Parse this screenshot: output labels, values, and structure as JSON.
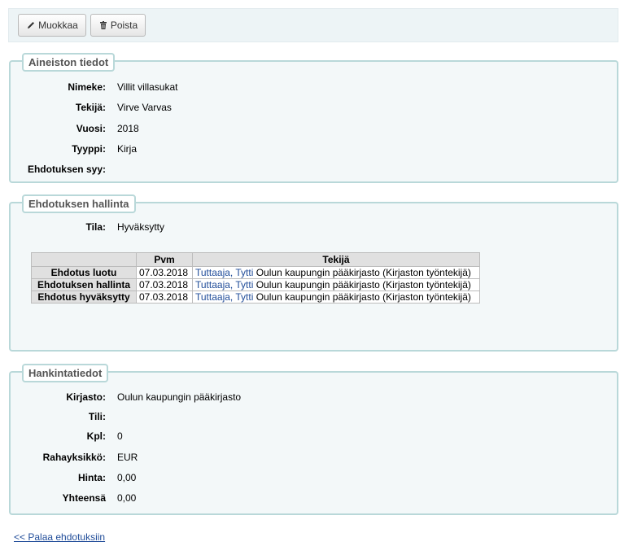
{
  "toolbar": {
    "edit_label": "Muokkaa",
    "edit_icon": "pencil-icon",
    "delete_label": "Poista",
    "delete_icon": "trash-icon"
  },
  "material": {
    "legend": "Aineiston tiedot",
    "fields": [
      {
        "label": "Nimeke:",
        "value": "Villit villasukat"
      },
      {
        "label": "Tekijä:",
        "value": "Virve Varvas"
      },
      {
        "label": "Vuosi:",
        "value": "2018"
      },
      {
        "label": "Tyyppi:",
        "value": "Kirja"
      },
      {
        "label": "Ehdotuksen syy:",
        "value": ""
      }
    ]
  },
  "management": {
    "legend": "Ehdotuksen hallinta",
    "status_label": "Tila:",
    "status_value": "Hyväksytty",
    "history": {
      "headers": [
        "",
        "Pvm",
        "Tekijä"
      ],
      "rows": [
        {
          "event": "Ehdotus luotu",
          "date": "07.03.2018",
          "user_link": "Tuttaaja, Tytti",
          "library": "Oulun kaupungin pääkirjasto (Kirjaston työntekijä)"
        },
        {
          "event": "Ehdotuksen hallinta",
          "date": "07.03.2018",
          "user_link": "Tuttaaja, Tytti",
          "library": "Oulun kaupungin pääkirjasto (Kirjaston työntekijä)"
        },
        {
          "event": "Ehdotus hyväksytty",
          "date": "07.03.2018",
          "user_link": "Tuttaaja, Tytti",
          "library": "Oulun kaupungin pääkirjasto (Kirjaston työntekijä)"
        }
      ]
    }
  },
  "acquisition": {
    "legend": "Hankintatiedot",
    "fields": [
      {
        "label": "Kirjasto:",
        "value": "Oulun kaupungin pääkirjasto"
      },
      {
        "label": "Tili:",
        "value": ""
      },
      {
        "label": "Kpl:",
        "value": "0"
      },
      {
        "label": "Rahayksikkö:",
        "value": "EUR"
      },
      {
        "label": "Hinta:",
        "value": "0,00"
      },
      {
        "label": "Yhteensä",
        "value": "0,00"
      }
    ]
  },
  "footer": {
    "back_link": "<< Palaa ehdotuksiin"
  },
  "colors": {
    "link": "#224e9a",
    "fieldset_border": "#b9d8d9",
    "fieldset_bg": "#f3f8f9",
    "toolbar_bg": "#edf4f6"
  }
}
